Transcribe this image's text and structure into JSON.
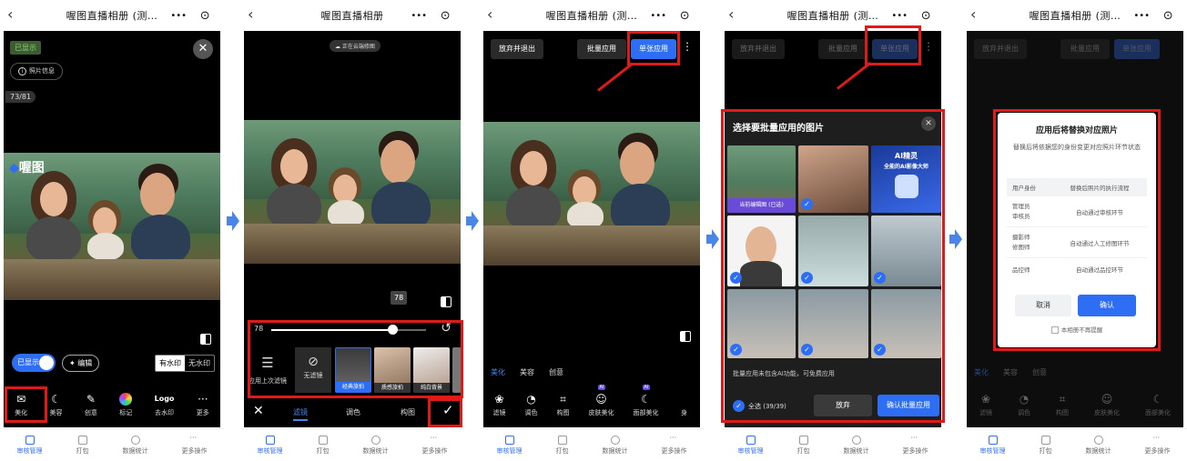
{
  "common": {
    "back_icon": "back-chevron-icon",
    "title_full": "喔图直播相册",
    "title_trunc": "喔图直播相册 (测…",
    "capsule_dots": "•••",
    "capsule_circle": "⊙",
    "tabs": [
      {
        "label": "审核管理",
        "icon": "review-icon"
      },
      {
        "label": "打包",
        "icon": "download-icon"
      },
      {
        "label": "数据统计",
        "icon": "stats-icon"
      },
      {
        "label": "更多操作",
        "icon": "more-icon"
      }
    ]
  },
  "panel1": {
    "badge_shown": "已显示",
    "photo_info": "照片信息",
    "counter": "73/81",
    "logo_text": "喔图",
    "toggle_label": "已显示",
    "edit_label": "编辑",
    "watermark_on": "有水印",
    "watermark_off": "无水印",
    "tools": [
      {
        "label": "美化",
        "glyph": "✉"
      },
      {
        "label": "美容",
        "glyph": "☾"
      },
      {
        "label": "创意",
        "glyph": "✎"
      },
      {
        "label": "标记",
        "glyph": "●"
      },
      {
        "label": "去水印",
        "glyph": "Logo"
      },
      {
        "label": "更多",
        "glyph": "···"
      }
    ]
  },
  "panel2": {
    "cloud_status": "正在云端修图",
    "slider_tooltip": "78",
    "slider_value": "78",
    "slider_level": 0.78,
    "reuse_label": "应用上次滤镜",
    "no_filter": "无滤镜",
    "filters": [
      "经典旅拍",
      "质感旅拍",
      "纯白背景"
    ],
    "tabs": [
      "滤镜",
      "调色",
      "构图"
    ]
  },
  "panel3": {
    "abandon_exit": "放弃并退出",
    "batch_apply": "批量应用",
    "single_apply": "单张应用",
    "subtabs": [
      "美化",
      "美容",
      "创意"
    ],
    "ai_badge": "AI",
    "tools": [
      {
        "label": "滤镜",
        "glyph": "❀"
      },
      {
        "label": "调色",
        "glyph": "◔"
      },
      {
        "label": "构图",
        "glyph": "⌗"
      },
      {
        "label": "皮肤美化",
        "glyph": "☺"
      },
      {
        "label": "面部美化",
        "glyph": "☾"
      },
      {
        "label": "身",
        "glyph": ""
      }
    ]
  },
  "panel4": {
    "sheet_title": "选择要批量应用的图片",
    "current_label": "当前编辑图 (已选)",
    "ad_line1": "AI精灵",
    "ad_line2": "全能的AI影像大师",
    "note": "批量应用未包含AI功能，可免费应用",
    "select_all": "全选 (39/39)",
    "abandon": "放弃",
    "confirm_batch": "确认批量应用"
  },
  "panel5": {
    "dialog_title": "应用后将替换对应照片",
    "dialog_desc": "替换后将依据您的身份变更对应照片环节状态",
    "table_head": [
      "用户身份",
      "替换后照片的执行流程"
    ],
    "rows": [
      {
        "role": "管理员\n审核员",
        "flow": "自动通过审核环节"
      },
      {
        "role": "摄影师\n修图师",
        "flow": "自动通过人工修图环节"
      },
      {
        "role": "品控师",
        "flow": "自动通过品控环节"
      }
    ],
    "cancel": "取消",
    "confirm": "确认",
    "no_remind": "本相册不再提醒"
  },
  "colors": {
    "accent": "#2d6ef5",
    "highlight": "#e01919",
    "dark_bg": "#000000"
  }
}
